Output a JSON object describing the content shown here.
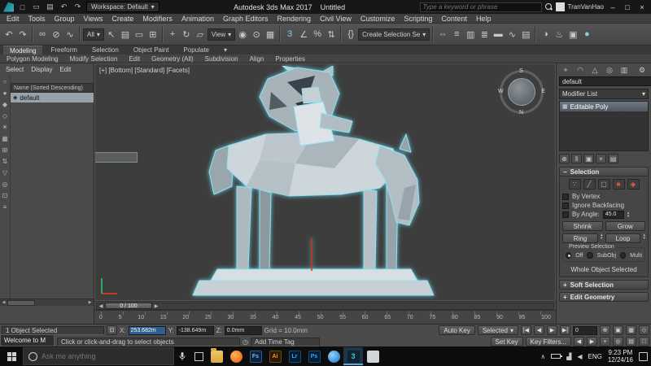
{
  "colors": {
    "selection_outline": "#8FE2F2",
    "object_color_swatch": "#D33FD3",
    "x_field_highlight": "#2D5F92",
    "max_teal": "#3EC6D8",
    "viewport_background": "#3D3D3D"
  },
  "icons": {
    "caret_down": "▾",
    "minimize": "–",
    "maximize": "□",
    "close": "×",
    "spin_up": "▴",
    "spin_down": "▾",
    "chevron_up": "∧",
    "volume": "◀",
    "signal": "▟",
    "clock": "◷",
    "lock": "⊡",
    "scroll_left": "◀",
    "scroll_right": "▶",
    "collapse_minus": "−",
    "expand_plus": "+"
  },
  "title_bar": {
    "quick_icons": [
      {
        "name": "new-scene-icon",
        "glyph": "□"
      },
      {
        "name": "open-file-icon",
        "glyph": "▭"
      },
      {
        "name": "save-file-icon",
        "glyph": "▤"
      },
      {
        "name": "undo-icon",
        "glyph": "↶"
      },
      {
        "name": "redo-icon",
        "glyph": "↷"
      }
    ],
    "workspace": "Workspace: Default",
    "app_title": "Autodesk 3ds Max 2017",
    "doc_title": "Untitled",
    "search_placeholder": "Type a keyword or phrase",
    "user": "TranVanHao"
  },
  "menu_bar": {
    "items": [
      "Edit",
      "Tools",
      "Group",
      "Views",
      "Create",
      "Modifiers",
      "Animation",
      "Graph Editors",
      "Rendering",
      "Civil View",
      "Customize",
      "Scripting",
      "Content",
      "Help"
    ]
  },
  "main_toolbar": {
    "selection_filter": "All",
    "ref_coord": "View",
    "selection_set_placeholder": "Create Selection Se",
    "icons": [
      {
        "name": "undo-icon",
        "glyph": "↶"
      },
      {
        "name": "redo-icon",
        "glyph": "↷"
      },
      {
        "name": "select-and-link-icon",
        "glyph": "∞"
      },
      {
        "name": "unlink-selection-icon",
        "glyph": "⊘"
      },
      {
        "name": "bind-to-space-warp-icon",
        "glyph": "∿"
      },
      {
        "name": "select-object-icon",
        "glyph": "↖"
      },
      {
        "name": "select-by-name-icon",
        "glyph": "▤"
      },
      {
        "name": "rectangular-selection-region-icon",
        "glyph": "▭"
      },
      {
        "name": "window-crossing-icon",
        "glyph": "⊞"
      },
      {
        "name": "select-and-move-icon",
        "glyph": "+"
      },
      {
        "name": "select-and-rotate-icon",
        "glyph": "↻"
      },
      {
        "name": "select-and-scale-icon",
        "glyph": "▱"
      },
      {
        "name": "use-pivot-point-icon",
        "glyph": "◉"
      },
      {
        "name": "select-and-manipulate-icon",
        "glyph": "⊙"
      },
      {
        "name": "keyboard-shortcut-override-icon",
        "glyph": "▦"
      },
      {
        "name": "snaps-toggle-icon",
        "glyph": "3"
      },
      {
        "name": "angle-snap-icon",
        "glyph": "∠"
      },
      {
        "name": "percent-snap-icon",
        "glyph": "%"
      },
      {
        "name": "spinner-snap-icon",
        "glyph": "⇅"
      },
      {
        "name": "edit-named-selection-sets-icon",
        "glyph": "{}"
      },
      {
        "name": "mirror-icon",
        "glyph": "⇔"
      },
      {
        "name": "align-icon",
        "glyph": "≡"
      },
      {
        "name": "toggle-scene-explorer-icon",
        "glyph": "▥"
      },
      {
        "name": "toggle-layer-explorer-icon",
        "glyph": "≣"
      },
      {
        "name": "toggle-ribbon-icon",
        "glyph": "▬"
      },
      {
        "name": "curve-editor-icon",
        "glyph": "∿"
      },
      {
        "name": "dope-sheet-icon",
        "glyph": "▤"
      },
      {
        "name": "slate-material-editor-icon",
        "glyph": "◑"
      },
      {
        "name": "render-setup-icon",
        "glyph": "♨"
      },
      {
        "name": "rendered-frame-window-icon",
        "glyph": "▣"
      },
      {
        "name": "render-production-icon",
        "glyph": "●"
      }
    ]
  },
  "ribbon": {
    "tabs": [
      {
        "label": "Modeling"
      },
      {
        "label": "Freeform"
      },
      {
        "label": "Selection"
      },
      {
        "label": "Object Paint"
      },
      {
        "label": "Populate"
      }
    ],
    "panels": [
      "Polygon Modeling",
      "Modify Selection",
      "Edit",
      "Geometry (All)",
      "Subdivision",
      "Align",
      "Properties"
    ]
  },
  "scene_explorer": {
    "menus": [
      "Select",
      "Display",
      "Edit"
    ],
    "column_header": "Name (Sorted Descending)",
    "item": "default",
    "side_icons": [
      {
        "name": "display-none-icon",
        "glyph": "○"
      },
      {
        "name": "display-all-icon",
        "glyph": "●"
      },
      {
        "name": "display-geometry-icon",
        "glyph": "◆"
      },
      {
        "name": "display-shapes-icon",
        "glyph": "◇"
      },
      {
        "name": "display-lights-icon",
        "glyph": "☀"
      },
      {
        "name": "display-cameras-icon",
        "glyph": "▦"
      },
      {
        "name": "display-helpers-icon",
        "glyph": "⊞"
      },
      {
        "name": "sort-icon",
        "glyph": "⇅"
      },
      {
        "name": "filter-icon",
        "glyph": "▽"
      },
      {
        "name": "find-icon",
        "glyph": "◎"
      },
      {
        "name": "lock-explorer-icon",
        "glyph": "⊡"
      },
      {
        "name": "explorer-settings-icon",
        "glyph": "≡"
      }
    ]
  },
  "viewport": {
    "label": "[+] [Bottom] [Standard] [Facets]",
    "compass": {
      "top": "S",
      "right": "E",
      "bottom": "N",
      "left": "W"
    }
  },
  "timeline": {
    "slider_label": "0 / 100",
    "ticks": [
      "0",
      "5",
      "10",
      "15",
      "20",
      "25",
      "30",
      "35",
      "40",
      "45",
      "50",
      "55",
      "60",
      "65",
      "70",
      "75",
      "80",
      "85",
      "90",
      "95",
      "100"
    ]
  },
  "command_panel": {
    "tabs": [
      {
        "name": "create-tab-icon",
        "glyph": "+"
      },
      {
        "name": "modify-tab-icon",
        "glyph": "◠"
      },
      {
        "name": "hierarchy-tab-icon",
        "glyph": "△"
      },
      {
        "name": "motion-tab-icon",
        "glyph": "◎"
      },
      {
        "name": "display-tab-icon",
        "glyph": "▥"
      },
      {
        "name": "utilities-tab-icon",
        "glyph": "⚙"
      }
    ],
    "object_name": "default",
    "modifier_list": "Modifier List",
    "stack_item": "Editable Poly",
    "stack_tools": [
      {
        "name": "pin-stack-icon",
        "glyph": "⊕"
      },
      {
        "name": "show-end-result-icon",
        "glyph": "‖"
      },
      {
        "name": "make-unique-icon",
        "glyph": "▣"
      },
      {
        "name": "remove-modifier-icon",
        "glyph": "×"
      },
      {
        "name": "configure-modifier-sets-icon",
        "glyph": "▤"
      }
    ],
    "selection": {
      "title": "Selection",
      "subobject_icons": [
        {
          "name": "vertex-icon",
          "glyph": "∵"
        },
        {
          "name": "edge-icon",
          "glyph": "╱"
        },
        {
          "name": "border-icon",
          "glyph": "▢"
        },
        {
          "name": "polygon-icon",
          "glyph": "■"
        },
        {
          "name": "element-icon",
          "glyph": "◆"
        }
      ],
      "by_vertex": "By Vertex",
      "ignore_backfacing": "Ignore Backfacing",
      "by_angle": "By Angle:",
      "angle_value": "45.0",
      "shrink": "Shrink",
      "grow": "Grow",
      "ring": "Ring",
      "loop": "Loop",
      "preview_title": "Preview Selection",
      "preview_off": "Off",
      "preview_subobj": "SubObj",
      "preview_multi": "Multi",
      "status": "Whole Object Selected"
    },
    "soft_selection": "Soft Selection",
    "edit_geometry": "Edit Geometry"
  },
  "status_bar": {
    "selection_status": "1 Object Selected",
    "prompt": "Click or click-and-drag to select objects",
    "x_label": "X:",
    "x_value": "253.682m",
    "y_label": "Y:",
    "y_value": "-138.649m",
    "z_label": "Z:",
    "z_value": "0.0mm",
    "grid": "Grid = 10.0mm",
    "add_time_tag": "Add Time Tag",
    "auto_key": "Auto Key",
    "set_key": "Set Key",
    "key_mode": "Selected",
    "key_filters": "Key Filters...",
    "frame": "0",
    "playback": [
      {
        "name": "go-to-start-icon",
        "glyph": "|◀"
      },
      {
        "name": "previous-frame-icon",
        "glyph": "◀"
      },
      {
        "name": "play-icon",
        "glyph": "▶"
      },
      {
        "name": "go-to-end-icon",
        "glyph": "▶|"
      }
    ],
    "mini_arrows": [
      {
        "name": "previous-key-icon",
        "glyph": "◀"
      },
      {
        "name": "next-key-icon",
        "glyph": "▶"
      }
    ],
    "nav_row1": [
      {
        "name": "zoom-icon",
        "glyph": "⊕"
      },
      {
        "name": "zoom-all-icon",
        "glyph": "▣"
      },
      {
        "name": "zoom-extents-icon",
        "glyph": "▦"
      },
      {
        "name": "field-of-view-icon",
        "glyph": "◇"
      }
    ],
    "nav_row2": [
      {
        "name": "pan-icon",
        "glyph": "+"
      },
      {
        "name": "orbit-icon",
        "glyph": "◎"
      },
      {
        "name": "maximize-viewport-toggle-icon",
        "glyph": "▤"
      },
      {
        "name": "zoom-region-icon",
        "glyph": "□"
      }
    ]
  },
  "overlay": {
    "welcome_window": "Welcome to M"
  },
  "taskbar": {
    "search_placeholder": "Ask me anything",
    "apps": [
      {
        "label": "Fs"
      },
      {
        "label": "Ai"
      },
      {
        "label": "Lr"
      },
      {
        "label": "Ps"
      }
    ],
    "max_label": "3",
    "lang": "ENG",
    "time": "9:23 PM",
    "date": "12/24/16"
  }
}
